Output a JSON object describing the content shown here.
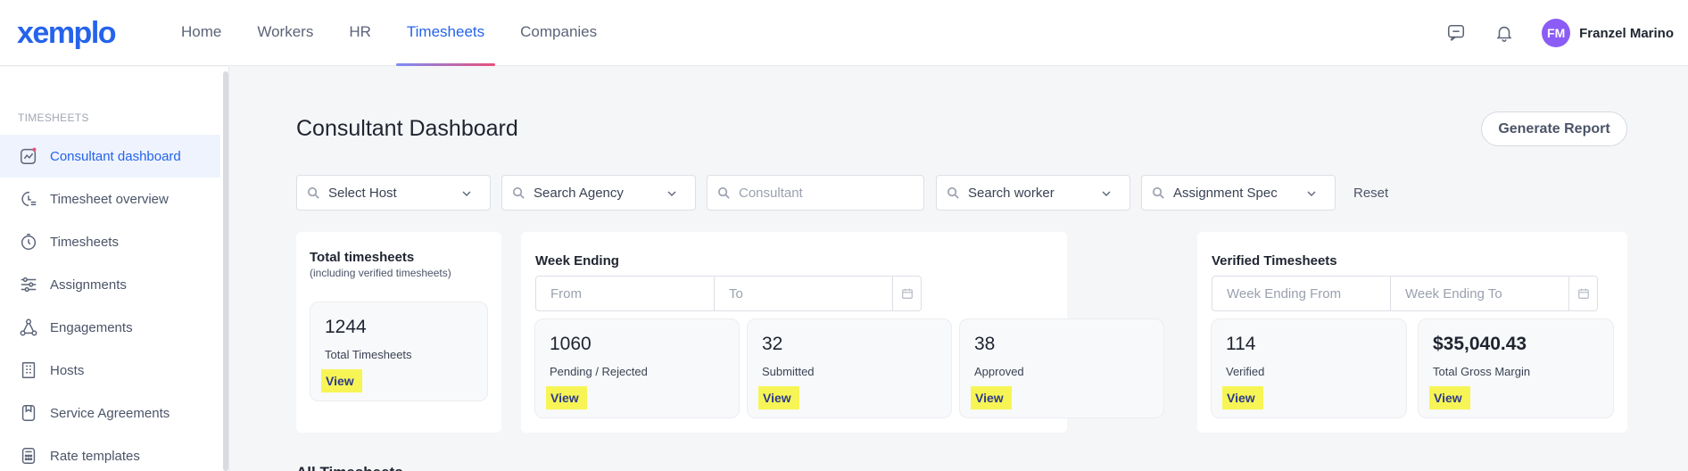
{
  "app": {
    "logo": "xemplo"
  },
  "nav": {
    "items": [
      {
        "label": "Home"
      },
      {
        "label": "Workers"
      },
      {
        "label": "HR"
      },
      {
        "label": "Timesheets",
        "active": true
      },
      {
        "label": "Companies"
      }
    ]
  },
  "user": {
    "initials": "FM",
    "name": "Franzel Marino"
  },
  "icons": {
    "chat": "chat-bubble-icon",
    "bell": "bell-icon",
    "search": "search-icon",
    "chevron": "chevron-down-icon",
    "calendar": "calendar-icon"
  },
  "colors": {
    "accent": "#2563eb",
    "avatar": "#8b5cf6",
    "highlight": "#f7f556"
  },
  "sidebar": {
    "header": "TIMESHEETS",
    "items": [
      {
        "label": "Consultant dashboard",
        "icon": "chart-line-icon",
        "active": true
      },
      {
        "label": "Timesheet overview",
        "icon": "clock-list-icon"
      },
      {
        "label": "Timesheets",
        "icon": "timer-icon"
      },
      {
        "label": "Assignments",
        "icon": "sliders-icon"
      },
      {
        "label": "Engagements",
        "icon": "network-icon"
      },
      {
        "label": "Hosts",
        "icon": "building-icon"
      },
      {
        "label": "Service Agreements",
        "icon": "bookmark-icon"
      },
      {
        "label": "Rate templates",
        "icon": "calculator-icon"
      }
    ]
  },
  "page": {
    "title": "Consultant Dashboard",
    "generate_report": "Generate Report",
    "all_timesheets": "All Timesheets"
  },
  "filters": {
    "host": "Select Host",
    "agency": "Search Agency",
    "consultant_placeholder": "Consultant",
    "worker": "Search worker",
    "assignment": "Assignment Spec",
    "reset": "Reset"
  },
  "total_card": {
    "title": "Total timesheets",
    "subtitle": "(including verified timesheets)",
    "stat": {
      "value": "1244",
      "label": "Total Timesheets",
      "view": "View"
    }
  },
  "week_card": {
    "title": "Week Ending",
    "from_placeholder": "From",
    "to_placeholder": "To",
    "stats": [
      {
        "value": "1060",
        "label": "Pending / Rejected",
        "view": "View"
      },
      {
        "value": "32",
        "label": "Submitted",
        "view": "View"
      },
      {
        "value": "38",
        "label": "Approved",
        "view": "View"
      }
    ]
  },
  "verified_card": {
    "title": "Verified Timesheets",
    "from_placeholder": "Week Ending From",
    "to_placeholder": "Week Ending To",
    "stats": [
      {
        "value": "114",
        "label": "Verified",
        "view": "View"
      },
      {
        "value": "$35,040.43",
        "label": "Total Gross Margin",
        "view": "View"
      }
    ]
  }
}
